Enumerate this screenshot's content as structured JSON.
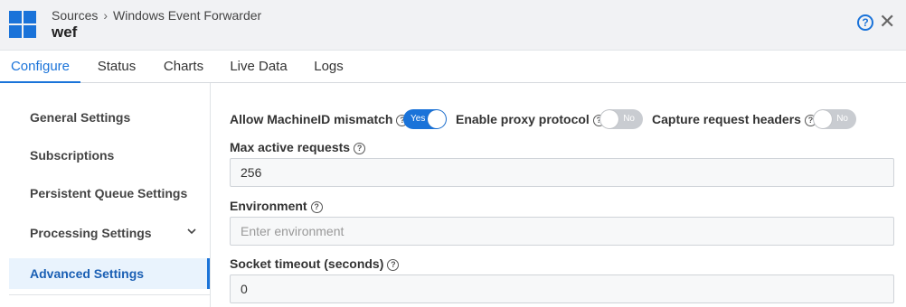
{
  "header": {
    "breadcrumb_parent": "Sources",
    "breadcrumb_separator": "›",
    "breadcrumb_current": "Windows Event Forwarder",
    "title": "wef",
    "help_glyph": "?",
    "close_glyph": "✕",
    "brand_color": "#1a73d9"
  },
  "tabs": [
    {
      "label": "Configure",
      "active": true
    },
    {
      "label": "Status"
    },
    {
      "label": "Charts"
    },
    {
      "label": "Live Data"
    },
    {
      "label": "Logs"
    }
  ],
  "sidebar": {
    "items": [
      {
        "label": "General Settings"
      },
      {
        "label": "Subscriptions"
      },
      {
        "label": "Persistent Queue Settings"
      },
      {
        "label": "Processing Settings",
        "icon": "chevron-down-icon"
      },
      {
        "label": "Advanced Settings",
        "active": true
      }
    ]
  },
  "form": {
    "allow_machineid": {
      "label": "Allow MachineID mismatch",
      "toggle_label": "Yes",
      "on": true
    },
    "enable_proxy": {
      "label": "Enable proxy protocol",
      "toggle_label": "No",
      "on": false
    },
    "capture_headers": {
      "label": "Capture request headers",
      "toggle_label": "No",
      "on": false
    },
    "max_active": {
      "label": "Max active requests",
      "value": "256"
    },
    "environment": {
      "label": "Environment",
      "value": "",
      "placeholder": "Enter environment"
    },
    "socket_timeout": {
      "label": "Socket timeout (seconds)",
      "value": "0"
    },
    "help_glyph": "?"
  }
}
